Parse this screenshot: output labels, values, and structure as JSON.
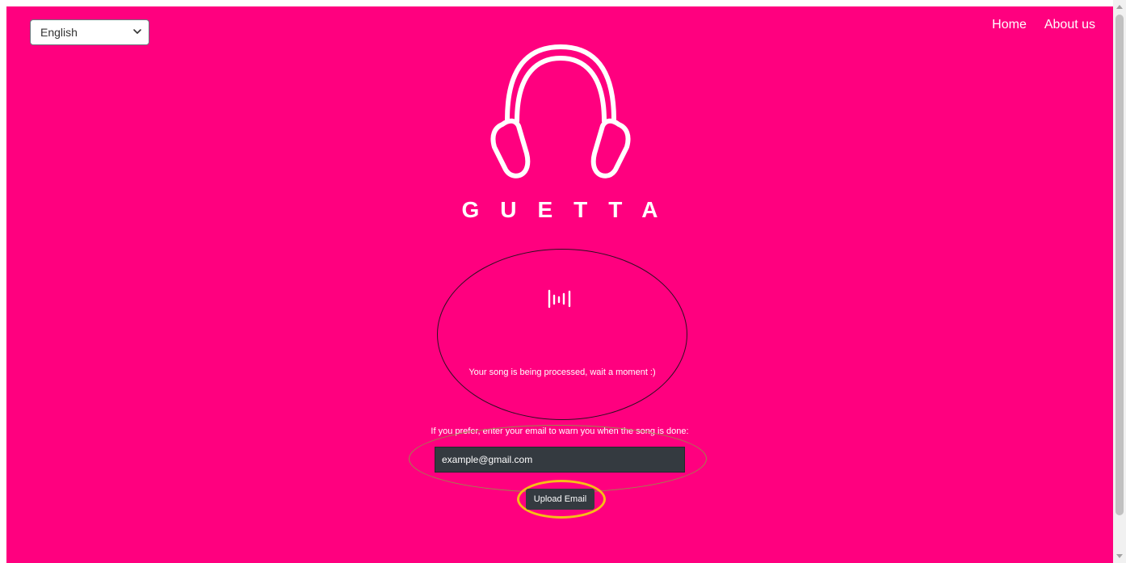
{
  "language_select": {
    "value": "English",
    "icon": "chevron-down-icon"
  },
  "nav": {
    "home": "Home",
    "about": "About us"
  },
  "logo": {
    "icon": "headphones-icon"
  },
  "brand": {
    "name": "GUETTA"
  },
  "processing": {
    "icon": "audio-wave-icon",
    "message": "Your song is being processed, wait a moment :)"
  },
  "email": {
    "prompt": "If you prefer, enter your email to warn you when the song is done:",
    "placeholder": "example@gmail.com",
    "upload_label": "Upload Email"
  },
  "colors": {
    "background": "#ff007f",
    "accent_ring": "#f6be16",
    "input_bg": "#343a40"
  }
}
